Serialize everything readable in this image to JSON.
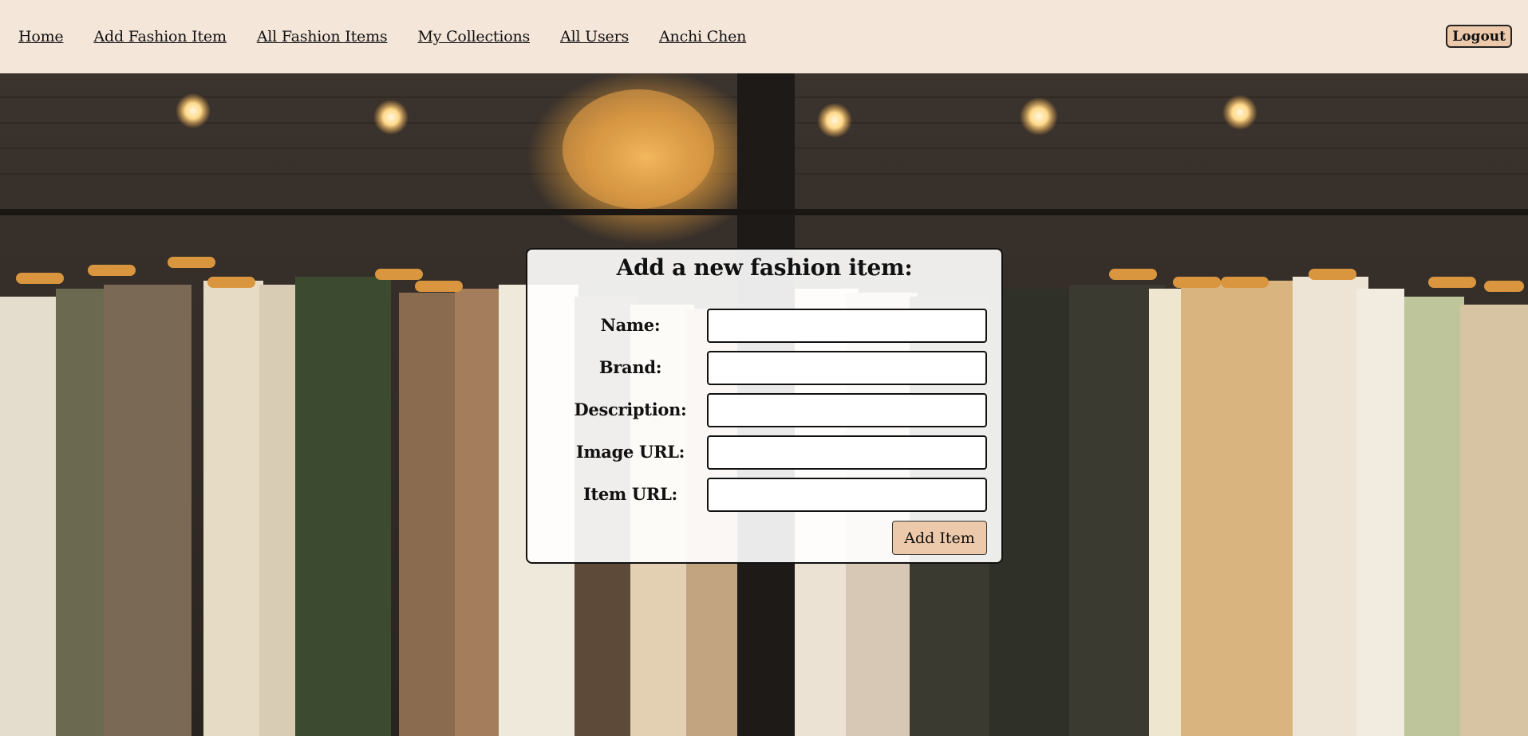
{
  "nav": {
    "links": [
      {
        "label": "Home"
      },
      {
        "label": "Add Fashion Item"
      },
      {
        "label": "All Fashion Items"
      },
      {
        "label": "My Collections"
      },
      {
        "label": "All Users"
      },
      {
        "label": "Anchi Chen"
      }
    ],
    "logout_label": "Logout"
  },
  "form": {
    "title": "Add a new fashion item:",
    "fields": [
      {
        "label": "Name:",
        "value": ""
      },
      {
        "label": "Brand:",
        "value": ""
      },
      {
        "label": "Description:",
        "value": ""
      },
      {
        "label": "Image URL:",
        "value": ""
      },
      {
        "label": "Item URL:",
        "value": ""
      }
    ],
    "submit_label": "Add Item"
  },
  "colors": {
    "navbar_bg": "#f5e6da",
    "button_bg": "#ecc9aa"
  }
}
